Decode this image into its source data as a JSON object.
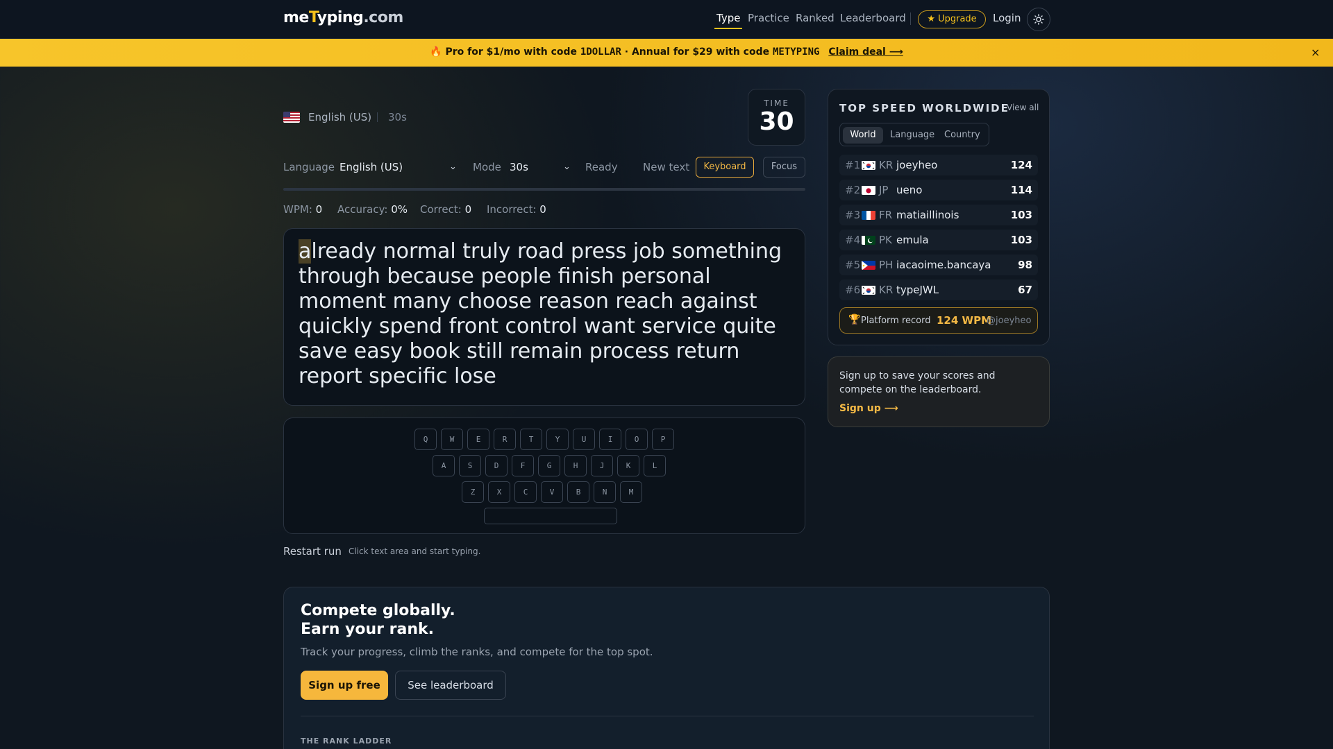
{
  "header": {
    "logo": {
      "prefix": "me",
      "y": "T",
      "rest": "yping",
      "domain": ".com"
    },
    "nav": [
      "Type",
      "Practice",
      "Ranked",
      "Leaderboard"
    ],
    "active_nav": "Type",
    "upgrade_label": "★ Upgrade",
    "login_label": "Login",
    "theme_icon": "sun-icon"
  },
  "promo": {
    "emoji": "🔥",
    "part1": "Pro for $1/mo with code ",
    "code1": "1DOLLAR",
    "part2": " · Annual for $29 with code ",
    "code2": "METYPING",
    "claim": "Claim deal ⟶",
    "close": "×"
  },
  "meta": {
    "language": "English (US)",
    "duration": "30s"
  },
  "timer": {
    "label": "TIME",
    "value": "30"
  },
  "controls": {
    "language_label": "Language",
    "language_value": "English (US)",
    "mode_label": "Mode",
    "mode_value": "30s",
    "status": "Ready",
    "new_text": "New text",
    "keyboard": "Keyboard",
    "focus": "Focus"
  },
  "progress": 0,
  "stats": {
    "wpm_label": "WPM:",
    "wpm": "0",
    "accuracy_label": "Accuracy:",
    "accuracy": "0%",
    "correct_label": "Correct:",
    "correct": "0",
    "incorrect_label": "Incorrect:",
    "incorrect": "0"
  },
  "typing": {
    "current_char": "a",
    "rest": "lready normal truly road press job something through because people finish personal moment many choose reason reach against quickly spend front control want service quite save easy book still remain process return report specific lose"
  },
  "keyboard": {
    "rows": [
      [
        "Q",
        "W",
        "E",
        "R",
        "T",
        "Y",
        "U",
        "I",
        "O",
        "P"
      ],
      [
        "A",
        "S",
        "D",
        "F",
        "G",
        "H",
        "J",
        "K",
        "L"
      ],
      [
        "Z",
        "X",
        "C",
        "V",
        "B",
        "N",
        "M"
      ]
    ]
  },
  "restart": {
    "label": "Restart run",
    "hint": "Click text area and start typing."
  },
  "leaderboard": {
    "title": "TOP SPEED WORLDWIDE",
    "view_all": "View all",
    "tabs": [
      "World",
      "Language",
      "Country"
    ],
    "rows": [
      {
        "rank": "#1",
        "cc": "KR",
        "name": "joeyheo",
        "score": "124"
      },
      {
        "rank": "#2",
        "cc": "JP",
        "name": "ueno",
        "score": "114"
      },
      {
        "rank": "#3",
        "cc": "FR",
        "name": "matiaillinois",
        "score": "103"
      },
      {
        "rank": "#4",
        "cc": "PK",
        "name": "emula",
        "score": "103"
      },
      {
        "rank": "#5",
        "cc": "PH",
        "name": "iacaoime.bancaya",
        "score": "98"
      },
      {
        "rank": "#6",
        "cc": "KR",
        "name": "typeJWL",
        "score": "67"
      }
    ],
    "record": {
      "icon": "🏆",
      "label": "Platform record",
      "wpm": "124 WPM",
      "user": "@joeyheo"
    }
  },
  "signup_card": {
    "text": "Sign up to save your scores and compete on the leaderboard.",
    "link": "Sign up ⟶"
  },
  "compete": {
    "title1": "Compete globally.",
    "title2": "Earn your rank.",
    "subtitle": "Track your progress, climb the ranks, and compete for the top spot.",
    "primary": "Sign up free",
    "secondary": "See leaderboard",
    "ladder": "THE RANK LADDER"
  },
  "colors": {
    "accent": "#f6c21c",
    "promo": "#f7c52a",
    "background": "#0f1720"
  }
}
